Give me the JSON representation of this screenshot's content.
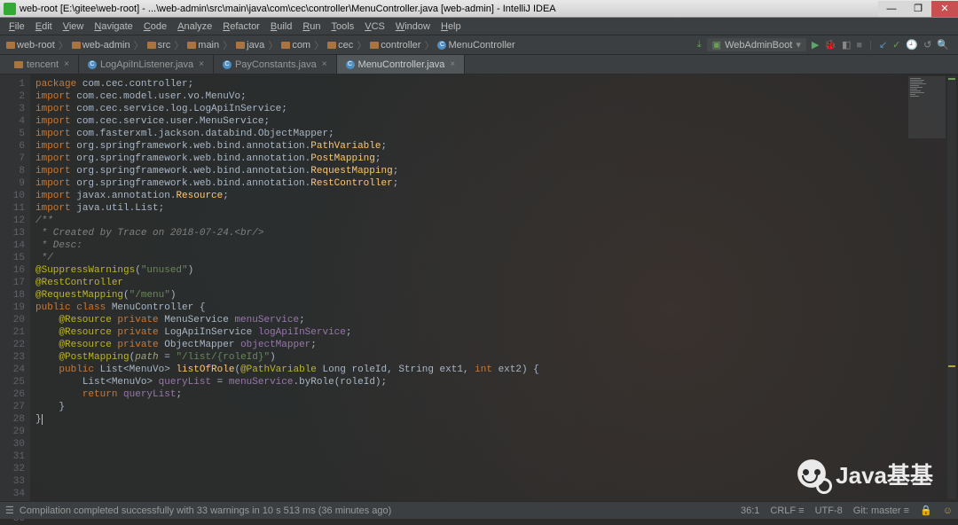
{
  "window": {
    "title": "web-root [E:\\gitee\\web-root] - ...\\web-admin\\src\\main\\java\\com\\cec\\controller\\MenuController.java [web-admin] - IntelliJ IDEA",
    "min": "—",
    "max": "❐",
    "close": "✕"
  },
  "menu": [
    "File",
    "Edit",
    "View",
    "Navigate",
    "Code",
    "Analyze",
    "Refactor",
    "Build",
    "Run",
    "Tools",
    "VCS",
    "Window",
    "Help"
  ],
  "breadcrumb": [
    "web-root",
    "web-admin",
    "src",
    "main",
    "java",
    "com",
    "cec",
    "controller",
    "MenuController"
  ],
  "run_config": "WebAdminBoot",
  "tabs": [
    {
      "label": "tencent",
      "active": false,
      "icon": "folder"
    },
    {
      "label": "LogApiInListener.java",
      "active": false,
      "icon": "class"
    },
    {
      "label": "PayConstants.java",
      "active": false,
      "icon": "class"
    },
    {
      "label": "MenuController.java",
      "active": true,
      "icon": "class"
    }
  ],
  "code_lines": [
    [
      [
        "kw",
        "package "
      ],
      [
        "pkg",
        "com.cec.controller"
      ],
      [
        "",
        ";"
      ]
    ],
    [
      [
        "",
        ""
      ]
    ],
    [
      [
        "kw",
        "import "
      ],
      [
        "pkg",
        "com.cec.model.user.vo.MenuVo"
      ],
      [
        "",
        ";"
      ]
    ],
    [
      [
        "kw",
        "import "
      ],
      [
        "pkg",
        "com.cec.service.log.LogApiInService"
      ],
      [
        "",
        ";"
      ]
    ],
    [
      [
        "kw",
        "import "
      ],
      [
        "pkg",
        "com.cec.service.user.MenuService"
      ],
      [
        "",
        ";"
      ]
    ],
    [
      [
        "kw",
        "import "
      ],
      [
        "pkg",
        "com.fasterxml.jackson.databind.ObjectMapper"
      ],
      [
        "",
        ";"
      ]
    ],
    [
      [
        "kw",
        "import "
      ],
      [
        "pkg",
        "org.springframework.web.bind.annotation."
      ],
      [
        "spec",
        "PathVariable"
      ],
      [
        "",
        ";"
      ]
    ],
    [
      [
        "kw",
        "import "
      ],
      [
        "pkg",
        "org.springframework.web.bind.annotation."
      ],
      [
        "spec",
        "PostMapping"
      ],
      [
        "",
        ";"
      ]
    ],
    [
      [
        "kw",
        "import "
      ],
      [
        "pkg",
        "org.springframework.web.bind.annotation."
      ],
      [
        "spec",
        "RequestMapping"
      ],
      [
        "",
        ";"
      ]
    ],
    [
      [
        "kw",
        "import "
      ],
      [
        "pkg",
        "org.springframework.web.bind.annotation."
      ],
      [
        "spec",
        "RestController"
      ],
      [
        "",
        ";"
      ]
    ],
    [
      [
        "",
        ""
      ]
    ],
    [
      [
        "kw",
        "import "
      ],
      [
        "pkg",
        "javax.annotation."
      ],
      [
        "spec",
        "Resource"
      ],
      [
        "",
        ";"
      ]
    ],
    [
      [
        "kw",
        "import "
      ],
      [
        "pkg",
        "java.util.List"
      ],
      [
        "",
        ";"
      ]
    ],
    [
      [
        "",
        ""
      ]
    ],
    [
      [
        "comment",
        "/**"
      ]
    ],
    [
      [
        "comment",
        " * Created by Trace on 2018-07-24.<br/>"
      ]
    ],
    [
      [
        "comment",
        " * Desc:"
      ]
    ],
    [
      [
        "comment",
        " */"
      ]
    ],
    [
      [
        "ann",
        "@SuppressWarnings"
      ],
      [
        "",
        "("
      ],
      [
        "str",
        "\"unused\""
      ],
      [
        "",
        ")"
      ]
    ],
    [
      [
        "ann",
        "@RestController"
      ]
    ],
    [
      [
        "ann",
        "@RequestMapping"
      ],
      [
        "",
        "("
      ],
      [
        "str",
        "\"/menu\""
      ],
      [
        "",
        ")"
      ]
    ],
    [
      [
        "kw",
        "public class "
      ],
      [
        "cls",
        "MenuController"
      ],
      [
        "",
        " {"
      ]
    ],
    [
      [
        "",
        ""
      ]
    ],
    [
      [
        "",
        "    "
      ],
      [
        "ann",
        "@Resource "
      ],
      [
        "kw",
        "private "
      ],
      [
        "typ",
        "MenuService "
      ],
      [
        "var",
        "menuService"
      ],
      [
        "",
        ";"
      ]
    ],
    [
      [
        "",
        "    "
      ],
      [
        "ann",
        "@Resource "
      ],
      [
        "kw",
        "private "
      ],
      [
        "typ",
        "LogApiInService "
      ],
      [
        "var",
        "logApiInService"
      ],
      [
        "",
        ";"
      ]
    ],
    [
      [
        "",
        "    "
      ],
      [
        "ann",
        "@Resource "
      ],
      [
        "kw",
        "private "
      ],
      [
        "typ",
        "ObjectMapper "
      ],
      [
        "var",
        "objectMapper"
      ],
      [
        "",
        ";"
      ]
    ],
    [
      [
        "",
        ""
      ]
    ],
    [
      [
        "",
        ""
      ]
    ],
    [
      [
        "",
        "    "
      ],
      [
        "ann",
        "@PostMapping"
      ],
      [
        "",
        "("
      ],
      [
        "ital",
        "path"
      ],
      [
        "",
        " = "
      ],
      [
        "str",
        "\"/list/{roleId}\""
      ],
      [
        "",
        ")"
      ]
    ],
    [
      [
        "",
        "    "
      ],
      [
        "kw",
        "public "
      ],
      [
        "typ",
        "List<MenuVo> "
      ],
      [
        "spec",
        "listOfRole"
      ],
      [
        "",
        "("
      ],
      [
        "ann",
        "@PathVariable "
      ],
      [
        "typ",
        "Long "
      ],
      [
        "",
        "roleId, "
      ],
      [
        "typ",
        "String "
      ],
      [
        "",
        "ext1, "
      ],
      [
        "kw",
        "int "
      ],
      [
        "",
        "ext2) {"
      ]
    ],
    [
      [
        "",
        "        "
      ],
      [
        "typ",
        "List<MenuVo> "
      ],
      [
        "var",
        "queryList"
      ],
      [
        "",
        " = "
      ],
      [
        "var",
        "menuService"
      ],
      [
        "",
        ".byRole(roleId);"
      ]
    ],
    [
      [
        "",
        "        "
      ],
      [
        "kw",
        "return "
      ],
      [
        "var",
        "queryList"
      ],
      [
        "",
        ";"
      ]
    ],
    [
      [
        "",
        "    }"
      ]
    ],
    [
      [
        "",
        ""
      ]
    ],
    [
      [
        "",
        ""
      ]
    ],
    [
      [
        "",
        "}"
      ]
    ]
  ],
  "gutter_markers": {
    "22": "green",
    "24": "green",
    "25": "green",
    "26": "green",
    "30": "red"
  },
  "status": {
    "msg": "Compilation completed successfully with 33 warnings in 10 s 513 ms (36 minutes ago)",
    "pos": "36:1",
    "crlf": "CRLF",
    "enc": "UTF-8",
    "git": "Git: master"
  },
  "watermark": "Java基基"
}
